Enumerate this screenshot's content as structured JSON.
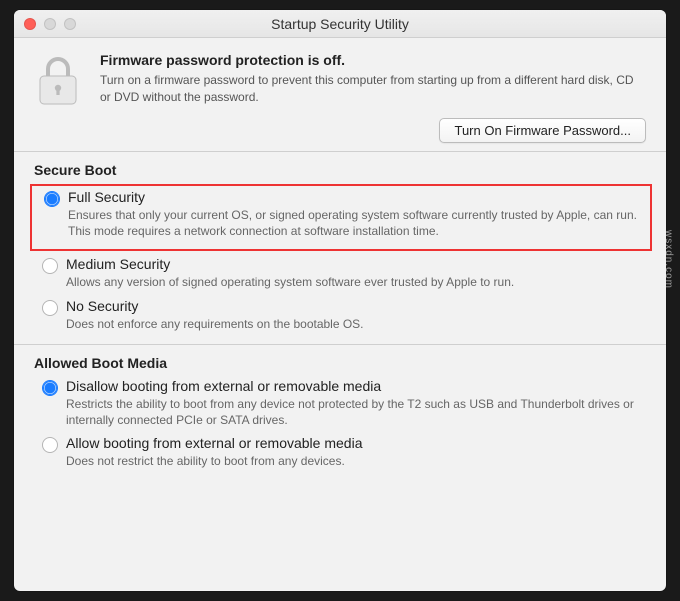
{
  "window": {
    "title": "Startup Security Utility"
  },
  "firmware": {
    "heading": "Firmware password protection is off.",
    "description": "Turn on a firmware password to prevent this computer from starting up from a different hard disk, CD or DVD without the password.",
    "button": "Turn On Firmware Password..."
  },
  "secure_boot": {
    "title": "Secure Boot",
    "options": [
      {
        "title": "Full Security",
        "desc": "Ensures that only your current OS, or signed operating system software currently trusted by Apple, can run. This mode requires a network connection at software installation time.",
        "checked": true
      },
      {
        "title": "Medium Security",
        "desc": "Allows any version of signed operating system software ever trusted by Apple to run.",
        "checked": false
      },
      {
        "title": "No Security",
        "desc": "Does not enforce any requirements on the bootable OS.",
        "checked": false
      }
    ]
  },
  "boot_media": {
    "title": "Allowed Boot Media",
    "options": [
      {
        "title": "Disallow booting from external or removable media",
        "desc": "Restricts the ability to boot from any device not protected by the T2 such as USB and Thunderbolt drives or internally connected PCIe or SATA drives.",
        "checked": true
      },
      {
        "title": "Allow booting from external or removable media",
        "desc": "Does not restrict the ability to boot from any devices.",
        "checked": false
      }
    ]
  },
  "watermark": "wsxdn.com"
}
